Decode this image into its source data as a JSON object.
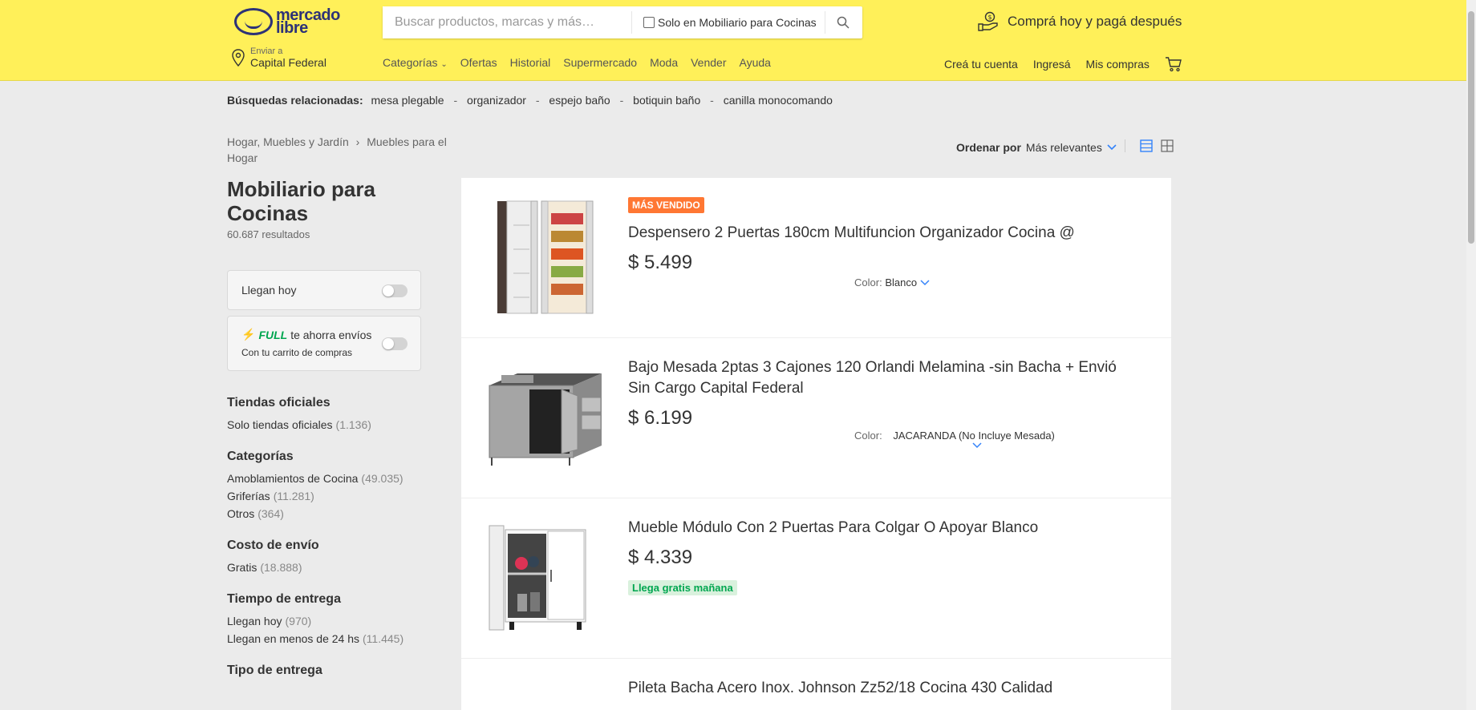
{
  "header": {
    "logo_line1": "mercado",
    "logo_line2": "libre",
    "search_placeholder": "Buscar productos, marcas y más…",
    "search_filter_label": "Solo en Mobiliario para Cocinas",
    "promo_text": "Comprá hoy y pagá después",
    "location_small": "Enviar a",
    "location_city": "Capital Federal",
    "nav": [
      "Categorías",
      "Ofertas",
      "Historial",
      "Supermercado",
      "Moda",
      "Vender",
      "Ayuda"
    ],
    "user_nav": [
      "Creá tu cuenta",
      "Ingresá",
      "Mis compras"
    ]
  },
  "related": {
    "label": "Búsquedas relacionadas:",
    "items": [
      "mesa plegable",
      "organizador",
      "espejo baño",
      "botiquin baño",
      "canilla monocomando"
    ],
    "separator": "-"
  },
  "breadcrumb": {
    "first": "Hogar, Muebles y Jardín",
    "second": "Muebles para el Hogar"
  },
  "page": {
    "title": "Mobiliario para Cocinas",
    "results": "60.687 resultados"
  },
  "toggles": {
    "today_label": "Llegan hoy",
    "full_brand": "FULL",
    "full_text": "te ahorra envíos",
    "full_sub": "Con tu carrito de compras"
  },
  "filters": [
    {
      "title": "Tiendas oficiales",
      "items": [
        {
          "label": "Solo tiendas oficiales",
          "count": "(1.136)"
        }
      ]
    },
    {
      "title": "Categorías",
      "items": [
        {
          "label": "Amoblamientos de Cocina",
          "count": "(49.035)"
        },
        {
          "label": "Griferías",
          "count": "(11.281)"
        },
        {
          "label": "Otros",
          "count": "(364)"
        }
      ]
    },
    {
      "title": "Costo de envío",
      "items": [
        {
          "label": "Gratis",
          "count": "(18.888)"
        }
      ]
    },
    {
      "title": "Tiempo de entrega",
      "items": [
        {
          "label": "Llegan hoy",
          "count": "(970)"
        },
        {
          "label": "Llegan en menos de 24 hs",
          "count": "(11.445)"
        }
      ]
    },
    {
      "title": "Tipo de entrega",
      "items": []
    }
  ],
  "sort": {
    "label": "Ordenar por",
    "value": "Más relevantes"
  },
  "products": [
    {
      "badge": "MÁS VENDIDO",
      "title": "Despensero 2 Puertas 180cm Multifuncion Organizador Cocina @",
      "price": "$ 5.499",
      "variation_label": "Color:",
      "variation_value": "Blanco"
    },
    {
      "title": "Bajo Mesada 2ptas 3 Cajones 120 Orlandi Melamina -sin Bacha + Envió Sin Cargo Capital Federal",
      "price": "$ 6.199",
      "variation_label": "Color:",
      "variation_value": "JACARANDA (No Incluye Mesada)"
    },
    {
      "title": "Mueble Módulo Con 2 Puertas Para Colgar O Apoyar Blanco",
      "price": "$ 4.339",
      "shipping": "Llega gratis mañana"
    },
    {
      "title": "Pileta Bacha Acero Inox. Johnson Zz52/18 Cocina 430 Calidad"
    }
  ],
  "colors": {
    "header_bg": "#fff059",
    "brand_blue": "#2d3277",
    "badge_orange": "#ff7733",
    "free_green": "#00a650",
    "link_blue": "#3483fa"
  }
}
